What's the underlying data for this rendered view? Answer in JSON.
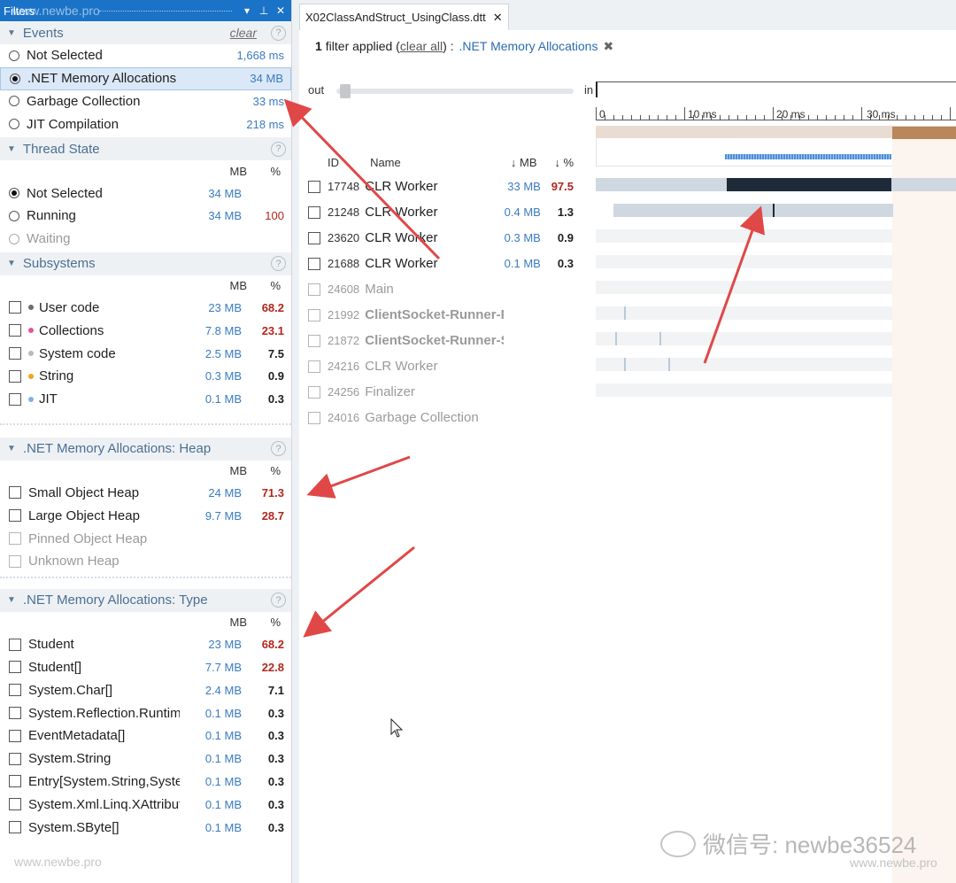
{
  "panel": {
    "title": "Filters",
    "watermark": "www.newbe.pro",
    "pin_glyph": "▾",
    "pin2_glyph": "ᵖ",
    "close_glyph": "✕"
  },
  "events": {
    "title": "Events",
    "clear": "clear",
    "help": "?",
    "items": [
      {
        "label": "Not Selected",
        "value": "1,668 ms",
        "selected": false
      },
      {
        "label": ".NET Memory Allocations",
        "value": "34 MB",
        "selected": true
      },
      {
        "label": "Garbage Collection",
        "value": "33 ms",
        "selected": false
      },
      {
        "label": "JIT Compilation",
        "value": "218 ms",
        "selected": false
      }
    ]
  },
  "thread_state": {
    "title": "Thread State",
    "help": "?",
    "col_mb": "MB",
    "col_pct": "%",
    "items": [
      {
        "label": "Not Selected",
        "mb": "34 MB",
        "pct": ""
      },
      {
        "label": "Running",
        "mb": "34 MB",
        "pct": "100"
      },
      {
        "label": "Waiting",
        "mb": "",
        "pct": ""
      }
    ]
  },
  "subsystems": {
    "title": "Subsystems",
    "help": "?",
    "col_mb": "MB",
    "col_pct": "%",
    "items": [
      {
        "label": "User code",
        "mb": "23 MB",
        "pct": "68.2",
        "color": "#6b6b6b"
      },
      {
        "label": "Collections",
        "mb": "7.8 MB",
        "pct": "23.1",
        "color": "#e0559a"
      },
      {
        "label": "System code",
        "mb": "2.5 MB",
        "pct": "7.5",
        "color": "#b9b9b9"
      },
      {
        "label": "String",
        "mb": "0.3 MB",
        "pct": "0.9",
        "color": "#f0a61c"
      },
      {
        "label": "JIT",
        "mb": "0.1 MB",
        "pct": "0.3",
        "color": "#7fb2e8"
      }
    ]
  },
  "heap": {
    "title": ".NET Memory Allocations: Heap",
    "help": "?",
    "col_mb": "MB",
    "col_pct": "%",
    "items": [
      {
        "label": "Small Object Heap",
        "mb": "24 MB",
        "pct": "71.3"
      },
      {
        "label": "Large Object Heap",
        "mb": "9.7 MB",
        "pct": "28.7"
      },
      {
        "label": "Pinned Object Heap",
        "mb": "",
        "pct": ""
      },
      {
        "label": "Unknown Heap",
        "mb": "",
        "pct": ""
      }
    ]
  },
  "type": {
    "title": ".NET Memory Allocations: Type",
    "help": "?",
    "col_mb": "MB",
    "col_pct": "%",
    "items": [
      {
        "label": "Student",
        "mb": "23 MB",
        "pct": "68.2"
      },
      {
        "label": "Student[]",
        "mb": "7.7 MB",
        "pct": "22.8"
      },
      {
        "label": "System.Char[]",
        "mb": "2.4 MB",
        "pct": "7.1"
      },
      {
        "label": "System.Reflection.Runtim...",
        "mb": "0.1 MB",
        "pct": "0.3"
      },
      {
        "label": "EventMetadata[]",
        "mb": "0.1 MB",
        "pct": "0.3"
      },
      {
        "label": "System.String",
        "mb": "0.1 MB",
        "pct": "0.3"
      },
      {
        "label": "Entry[System.String,Syste...",
        "mb": "0.1 MB",
        "pct": "0.3"
      },
      {
        "label": "System.Xml.Linq.XAttribute",
        "mb": "0.1 MB",
        "pct": "0.3"
      },
      {
        "label": "System.SByte[]",
        "mb": "0.1 MB",
        "pct": "0.3"
      }
    ]
  },
  "footer_watermark": "www.newbe.pro",
  "tab": {
    "label": "X02ClassAndStruct_UsingClass.dtt",
    "close": "✕"
  },
  "filterbar": {
    "count": "1",
    "text": "filter applied (",
    "clear_all": "clear all",
    "text2": ") :",
    "filter_name": ".NET Memory Allocations",
    "remove": "✖"
  },
  "zoom": {
    "out": "out",
    "in": "in"
  },
  "ruler": {
    "t0": "0",
    "t1": "10 ms",
    "t2": "20 ms",
    "t3": "30 ms"
  },
  "threads": {
    "col_id": "ID",
    "col_name": "Name",
    "col_mb": "↓ MB",
    "col_pct": "↓ %",
    "rows": [
      {
        "id": "17748",
        "name": "CLR Worker",
        "mb": "33 MB",
        "pct": "97.5",
        "dim": false,
        "bold": false
      },
      {
        "id": "21248",
        "name": "CLR Worker",
        "mb": "0.4 MB",
        "pct": "1.3",
        "dim": false,
        "bold": false
      },
      {
        "id": "23620",
        "name": "CLR Worker",
        "mb": "0.3 MB",
        "pct": "0.9",
        "dim": false,
        "bold": false
      },
      {
        "id": "21688",
        "name": "CLR Worker",
        "mb": "0.1 MB",
        "pct": "0.3",
        "dim": false,
        "bold": false
      },
      {
        "id": "24608",
        "name": "Main",
        "mb": "",
        "pct": "",
        "dim": true,
        "bold": false
      },
      {
        "id": "21992",
        "name": "ClientSocket-Runner-R...",
        "mb": "",
        "pct": "",
        "dim": true,
        "bold": true
      },
      {
        "id": "21872",
        "name": "ClientSocket-Runner-S...",
        "mb": "",
        "pct": "",
        "dim": true,
        "bold": true
      },
      {
        "id": "24216",
        "name": "CLR Worker",
        "mb": "",
        "pct": "",
        "dim": true,
        "bold": false
      },
      {
        "id": "24256",
        "name": "Finalizer",
        "mb": "",
        "pct": "",
        "dim": true,
        "bold": false
      },
      {
        "id": "24016",
        "name": "Garbage Collection",
        "mb": "",
        "pct": "",
        "dim": true,
        "bold": false
      }
    ]
  },
  "watermark_wechat": "微信号: newbe36524",
  "watermark_site": "www.newbe.pro",
  "colors": {
    "accent": "#1a73c7",
    "value_blue": "#3a7bc0",
    "pct_red": "#b3261e",
    "arrow_red": "#e04848"
  }
}
